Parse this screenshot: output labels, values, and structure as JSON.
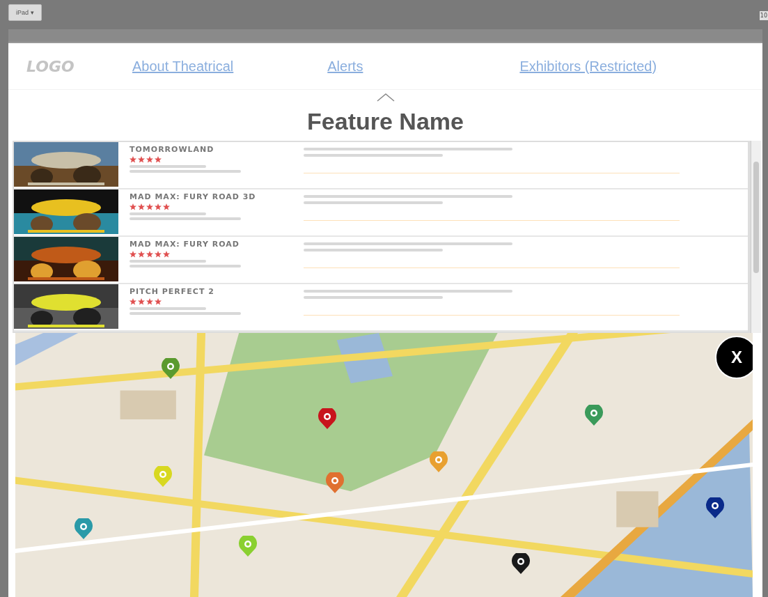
{
  "toolbar": {
    "device_button": "iPad ▾",
    "cut_label": "10"
  },
  "nav": {
    "logo": "LOGO",
    "links": [
      "About Theatrical",
      "Alerts",
      "Exhibitors (Restricted)"
    ]
  },
  "feature": {
    "title": "Feature Name"
  },
  "movies": [
    {
      "title": "TOMORROWLAND",
      "stars": 4
    },
    {
      "title": "MAD MAX: FURY ROAD 3D",
      "stars": 5
    },
    {
      "title": "MAD MAX: FURY ROAD",
      "stars": 5
    },
    {
      "title": "PITCH PERFECT 2",
      "stars": 4
    }
  ],
  "map": {
    "close_label": "X",
    "pins": [
      {
        "color": "#5a9a2e"
      },
      {
        "color": "#c8141c"
      },
      {
        "color": "#3a9a5a"
      },
      {
        "color": "#e8a030"
      },
      {
        "color": "#d8d820"
      },
      {
        "color": "#e07030"
      },
      {
        "color": "#2a9aa8"
      },
      {
        "color": "#8ad030"
      },
      {
        "color": "#1a1a1a"
      },
      {
        "color": "#0a2a8a"
      }
    ]
  }
}
